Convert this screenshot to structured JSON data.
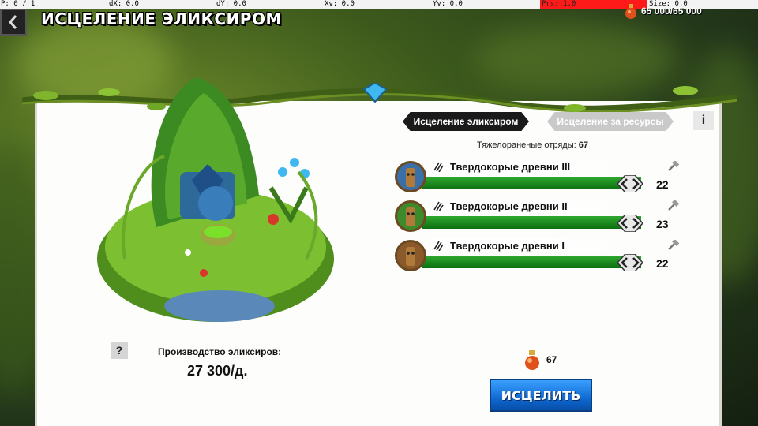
{
  "debug": {
    "p": "P: 0 / 1",
    "dx": "dX: 0.0",
    "dy": "dY: 0.0",
    "xv": "Xv: 0.0",
    "yv": "Yv: 0.0",
    "prs": "Prs: 1.0",
    "size": "Size: 0.0"
  },
  "header": {
    "title": "ИСЦЕЛЕНИЕ ЭЛИКСИРОМ",
    "resource": "65 000/65 000"
  },
  "tabs": {
    "active": "Исцеление эликсиром",
    "inactive": "Исцеление за ресурсы",
    "info": "i"
  },
  "wounded": {
    "label": "Тяжелораненые отряды:",
    "value": "67"
  },
  "units": [
    {
      "name": "Твердокорые древни III",
      "count": "22"
    },
    {
      "name": "Твердокорые древни II",
      "count": "23"
    },
    {
      "name": "Твердокорые древни I",
      "count": "22"
    }
  ],
  "production": {
    "help": "?",
    "label": "Производство эликсиров:",
    "value": "27 300/д."
  },
  "cost": {
    "value": "67"
  },
  "actions": {
    "heal": "ИСЦЕЛИТЬ"
  },
  "colors": {
    "panel": "#fdfdfb",
    "heal_button": "#1a7ee8",
    "health_bar": "#16881a",
    "active_tab": "#1a1a1a",
    "inactive_tab": "#c9c9c9",
    "debug_prs": "#ff1a1a"
  },
  "icons": {
    "back": "chevron-left-icon",
    "resource": "elixir-bottle-icon",
    "unit_status": "wound-claw-icon",
    "unit_tool": "hammer-icon",
    "slider": "double-arrow-icon"
  }
}
